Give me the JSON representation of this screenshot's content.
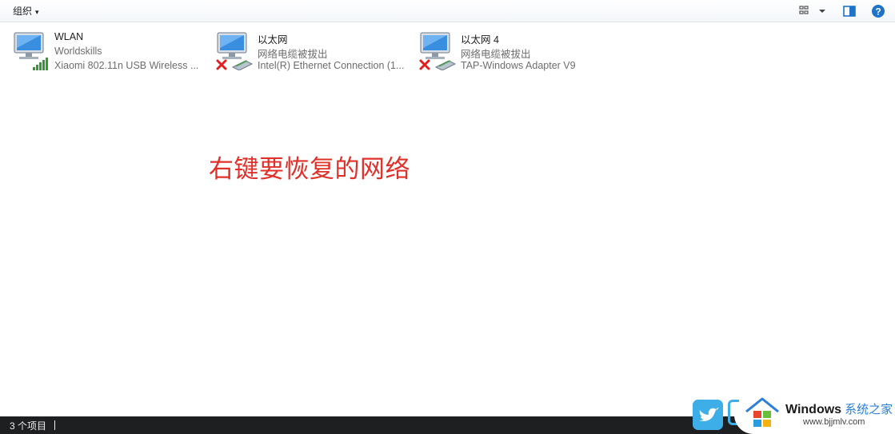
{
  "toolbar": {
    "organize_label": "组织",
    "organize_caret": "▾",
    "view_icon": "view-options-icon",
    "pane_icon": "preview-pane-icon",
    "help_icon": "help-icon",
    "help_glyph": "?",
    "accent": "#1e73c8"
  },
  "adapters": [
    {
      "name": "WLAN",
      "status": "Worldskills",
      "device": "Xiaomi 802.11n USB Wireless ...",
      "icon": "wireless-adapter-icon",
      "connected": true
    },
    {
      "name": "以太网",
      "status": "网络电缆被拔出",
      "device": "Intel(R) Ethernet Connection (1...",
      "icon": "ethernet-adapter-disconnected-icon",
      "connected": false
    },
    {
      "name": "以太网 4",
      "status": "网络电缆被拔出",
      "device": "TAP-Windows Adapter V9",
      "icon": "ethernet-adapter-disconnected-icon",
      "connected": false
    }
  ],
  "annotation": {
    "text": "右键要恢复的网络",
    "color": "#e0302a"
  },
  "statusbar": {
    "item_count": "3 个项目"
  },
  "watermark": {
    "brand": "Windows",
    "brand_cn": "系统之家",
    "url": "www.bjjmlv.com"
  }
}
